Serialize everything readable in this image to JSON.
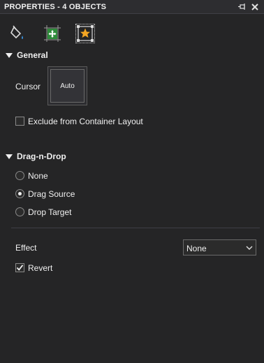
{
  "panel": {
    "title": "PROPERTIES - 4 OBJECTS",
    "pin_icon": "pin-icon",
    "close_icon": "close-icon"
  },
  "tabs": [
    {
      "icon": "paint-bucket-icon",
      "selected": false
    },
    {
      "icon": "layout-move-icon",
      "selected": false
    },
    {
      "icon": "star-behavior-icon",
      "selected": true
    }
  ],
  "general": {
    "header": "General",
    "cursor_label": "Cursor",
    "cursor_value": "Auto",
    "exclude_label": "Exclude from Container Layout",
    "exclude_checked": false
  },
  "dragdrop": {
    "header": "Drag-n-Drop",
    "options": [
      "None",
      "Drag Source",
      "Drop Target"
    ],
    "selected": "Drag Source",
    "effect_label": "Effect",
    "effect_value": "None",
    "revert_label": "Revert",
    "revert_checked": true
  },
  "colors": {
    "background": "#252526",
    "text": "#f0f0f0",
    "accent_star": "#f5a623",
    "accent_green": "#2e8b3a"
  }
}
